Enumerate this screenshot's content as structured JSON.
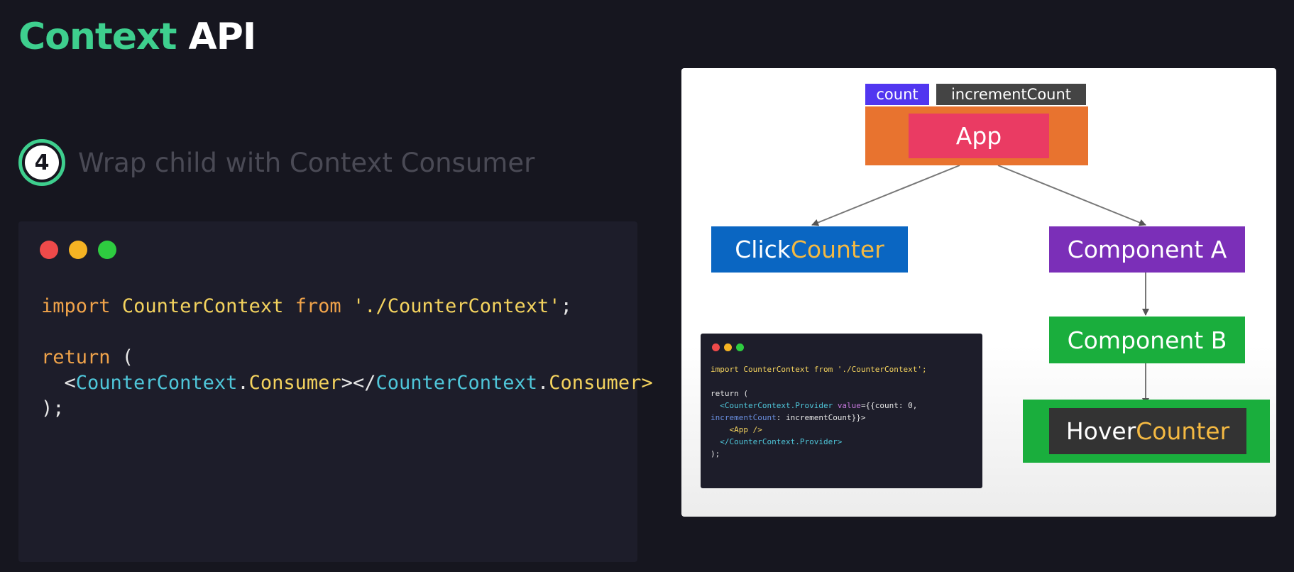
{
  "title": {
    "part1": "Context",
    "part2": "API"
  },
  "step": {
    "number": "4",
    "text": "Wrap child with Context Consumer"
  },
  "code": {
    "line1": {
      "kw1": "import",
      "name": "CounterContext",
      "kw2": "from",
      "path": "'./CounterContext'",
      "semi": ";"
    },
    "line2": {
      "kw": "return",
      "paren": " ("
    },
    "line3": {
      "open": "<",
      "ctx": "CounterContext",
      "dot": ".",
      "comp": "Consumer",
      "close": ">"
    },
    "line4": {
      "open": "</",
      "ctx": "CounterContext",
      "dot": ".",
      "comp": "Consumer",
      "close": ">"
    },
    "line5": ");"
  },
  "diagram": {
    "tags": {
      "count": "count",
      "increment": "incrementCount"
    },
    "nodes": {
      "app": "App",
      "click_counter": {
        "part1": "Click",
        "part2": "Counter"
      },
      "component_a": "Component A",
      "component_b": "Component B",
      "hover_counter": {
        "part1": "Hover",
        "part2": "Counter"
      }
    },
    "mini_code": {
      "l1a": "import CounterContext from './CounterContext';",
      "l2": "return (",
      "l3a": "  <CounterContext.Provider ",
      "l3b": "value",
      "l3c": "={{count: 0,",
      "l4a": "incrementCount",
      "l4b": ": incrementCount}}>",
      "l5": "    <App />",
      "l6": "  </CounterContext.Provider>",
      "l7": ");"
    }
  },
  "colors": {
    "accent": "#3ecf8e",
    "app_outer": "#e8732f",
    "app_inner": "#ea3b63",
    "click_counter": "#0a66c2",
    "component_a": "#7b2fb8",
    "component_b": "#1aae3d",
    "hover_outer": "#1aae3d",
    "hover_inner": "#333333",
    "counter_highlight": "#f4b942",
    "count_tag": "#5136f0",
    "increment_tag": "#444444"
  }
}
